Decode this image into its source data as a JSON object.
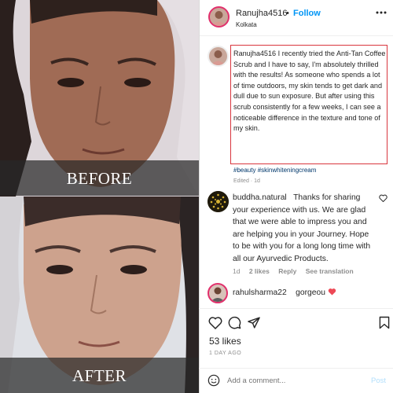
{
  "photos": {
    "before_label": "BEFORE",
    "after_label": "AFTER"
  },
  "header": {
    "username": "Ranujha4516",
    "dot": "•",
    "follow_label": "Follow",
    "location": "Kolkata"
  },
  "caption": {
    "username": "Ranujha4516",
    "text": "I recently tried the Anti-Tan Coffee Scrub and I have to say, I'm absolutely thrilled with the results! As someone who spends a lot of time outdoors, my skin tends to get dark and dull due to sun exposure. But after using this scrub consistently for a few weeks, I can see a noticeable difference in the texture and tone of my skin.",
    "hashtags": "#beauty #skinwhiteningcream",
    "edited": "Edited · 1d"
  },
  "comments": [
    {
      "username": "buddha.natural",
      "text": "Thanks for sharing your experience with us. We are glad that we were able to impress you and are helping you in your Journey. Hope to be with you for a long long time with all our Ayurvedic Products.",
      "time": "1d",
      "likes": "2 likes",
      "reply": "Reply",
      "see_translation": "See translation"
    },
    {
      "username": "rahulsharma22",
      "text": "gorgeou"
    }
  ],
  "actions": {
    "likes": "53 likes",
    "date": "1 DAY AGO"
  },
  "add_comment": {
    "placeholder": "Add a comment...",
    "post_label": "Post"
  },
  "colors": {
    "follow": "#0095f6",
    "highlight_box": "#d9363e",
    "heart": "#ed4956"
  }
}
